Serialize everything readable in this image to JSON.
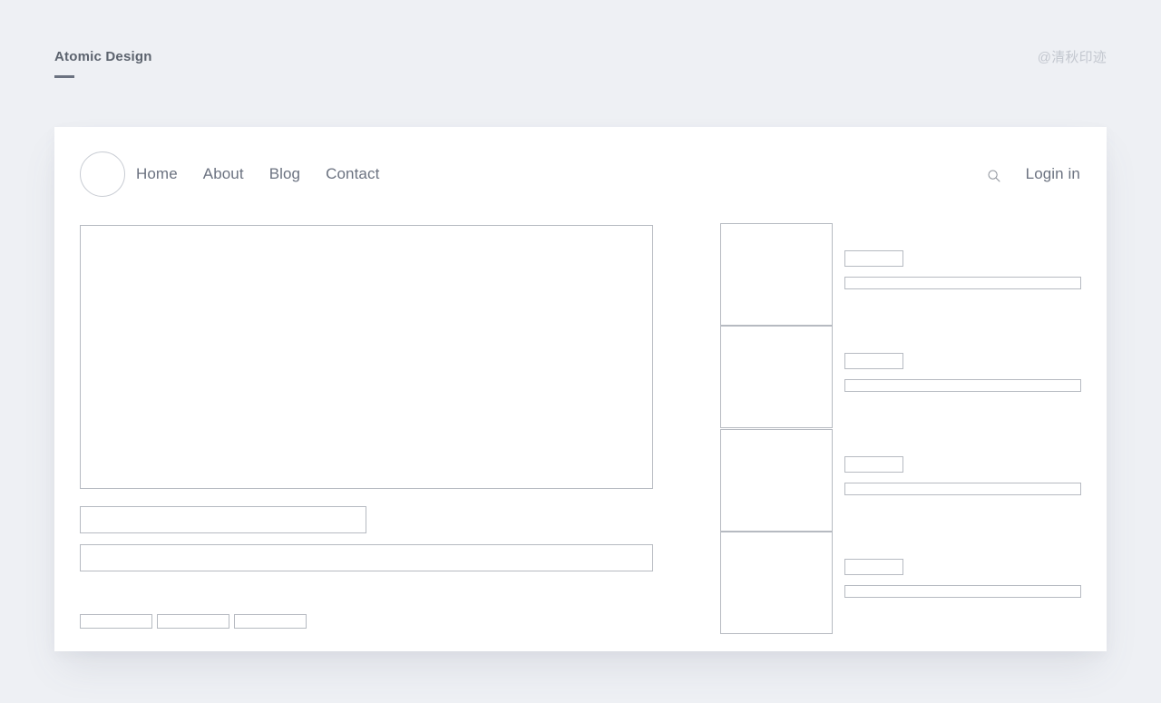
{
  "header": {
    "title": "Atomic Design",
    "watermark": "@清秋印迹"
  },
  "colors": {
    "page_background": "#eef0f4",
    "panel_background": "#ffffff",
    "text_gray": "#6b7280",
    "title_gray": "#5c636e",
    "wireframe_border": "#b6bac1",
    "watermark_gray": "#c3c7cf"
  },
  "navbar": {
    "logo": "circle-logo",
    "links": [
      {
        "label": "Home"
      },
      {
        "label": "About"
      },
      {
        "label": "Blog"
      },
      {
        "label": "Contact"
      }
    ],
    "search_icon": "search-icon",
    "login_label": "Login in"
  },
  "main": {
    "hero_placeholder": "",
    "heading_placeholder": "",
    "subheading_placeholder": "",
    "tags": [
      {
        "label": ""
      },
      {
        "label": ""
      },
      {
        "label": ""
      }
    ]
  },
  "sidebar": {
    "cards": [
      {
        "thumbnail": "",
        "title": "",
        "text": ""
      },
      {
        "thumbnail": "",
        "title": "",
        "text": ""
      },
      {
        "thumbnail": "",
        "title": "",
        "text": ""
      },
      {
        "thumbnail": "",
        "title": "",
        "text": ""
      }
    ]
  }
}
